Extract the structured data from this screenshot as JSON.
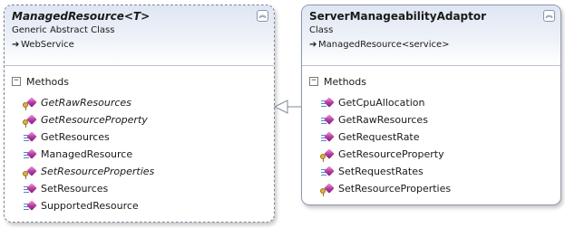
{
  "classes": [
    {
      "name": "ManagedResource<T>",
      "stereotype": "Generic Abstract Class",
      "inherits": "WebService",
      "compartment": "Methods",
      "methods": [
        {
          "label": "GetRawResources",
          "italic": true,
          "kind": "protected"
        },
        {
          "label": "GetResourceProperty",
          "italic": true,
          "kind": "protected"
        },
        {
          "label": "GetResources",
          "italic": false,
          "kind": "public"
        },
        {
          "label": "ManagedResource",
          "italic": false,
          "kind": "public"
        },
        {
          "label": "SetResourceProperties",
          "italic": true,
          "kind": "protected"
        },
        {
          "label": "SetResources",
          "italic": false,
          "kind": "public"
        },
        {
          "label": "SupportedResource",
          "italic": false,
          "kind": "public"
        }
      ]
    },
    {
      "name": "ServerManageabilityAdaptor",
      "stereotype": "Class",
      "inherits": "ManagedResource<service>",
      "compartment": "Methods",
      "methods": [
        {
          "label": "GetCpuAllocation",
          "italic": false,
          "kind": "public"
        },
        {
          "label": "GetRawResources",
          "italic": false,
          "kind": "public"
        },
        {
          "label": "GetRequestRate",
          "italic": false,
          "kind": "public"
        },
        {
          "label": "GetResourceProperty",
          "italic": false,
          "kind": "protected"
        },
        {
          "label": "SetRequestRates",
          "italic": false,
          "kind": "public"
        },
        {
          "label": "SetResourceProperties",
          "italic": false,
          "kind": "protected"
        }
      ]
    }
  ],
  "icons": {
    "collapse": "double-chevron-up-icon",
    "inherit": "arrow-right-icon",
    "public_method": "method-icon",
    "protected_method": "protected-method-icon",
    "compartment_toggle": "minus-icon"
  },
  "colors": {
    "border": "#8d99ab",
    "header_gradient_top": "#dfe6f3",
    "method_icon": "#b23aa1"
  }
}
